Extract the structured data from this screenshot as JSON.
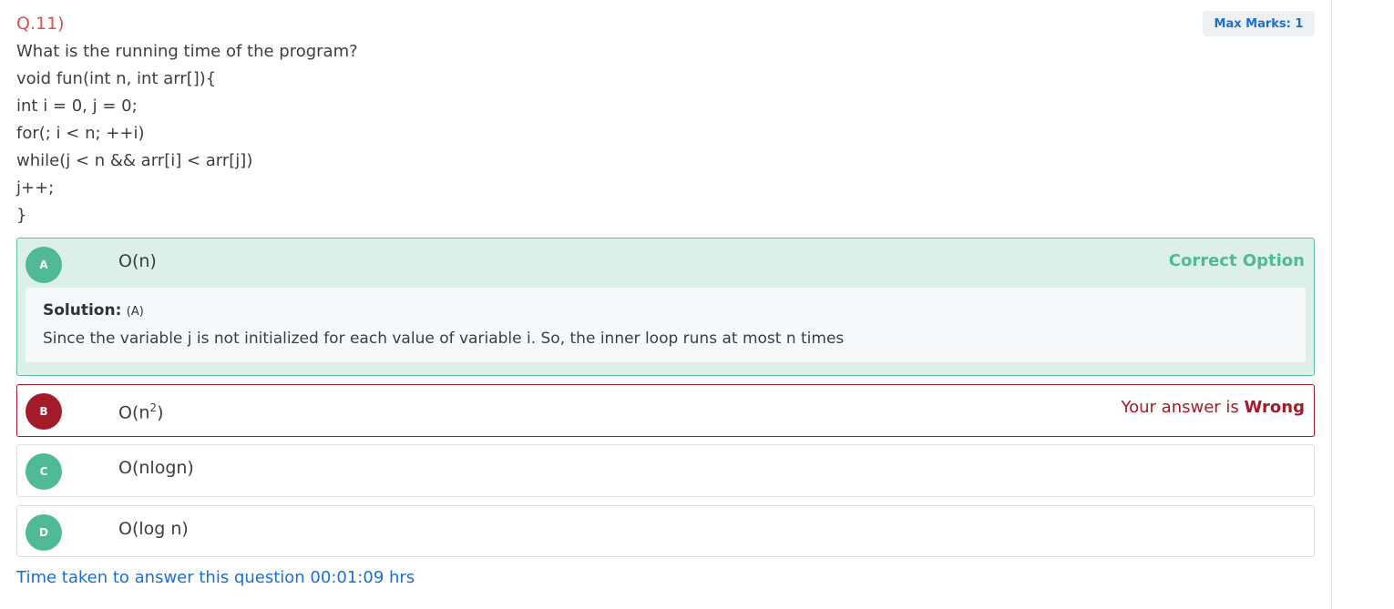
{
  "question": {
    "number": "Q.11)",
    "max_marks": "Max Marks: 1",
    "lines": [
      "What is the running time of the program?",
      "void fun(int n, int arr[]){",
      "int i = 0, j = 0;",
      "for(; i < n; ++i)",
      "while(j < n && arr[i] < arr[j])",
      "j++;",
      "}"
    ]
  },
  "options": [
    {
      "letter": "A",
      "text": "O(n)",
      "status": "Correct Option"
    },
    {
      "letter": "B",
      "text_base": "O(n",
      "text_sup": "2",
      "text_end": ")",
      "status_prefix": "Your answer is ",
      "status_emphasis": "Wrong"
    },
    {
      "letter": "C",
      "text": "O(nlogn)"
    },
    {
      "letter": "D",
      "text": "O(log n)"
    }
  ],
  "solution": {
    "label": "Solution:",
    "answer": "(A)",
    "text": "Since the variable j is not initialized for each value of variable i. So, the inner loop runs at most n times"
  },
  "time_taken": "Time taken to answer this question 00:01:09 hrs",
  "colors": {
    "question_number": "#d9534f",
    "accent_blue": "#1b6fd1",
    "correct_green": "#4fba94",
    "wrong_red": "#a31b28"
  }
}
